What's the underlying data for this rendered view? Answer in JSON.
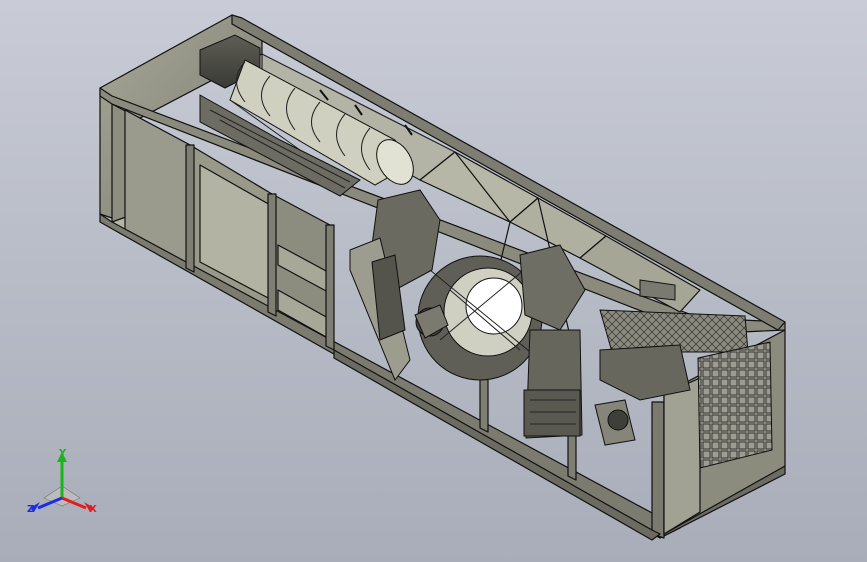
{
  "viewport": {
    "background_top": "#c9ccd6",
    "background_bottom": "#a9adb9"
  },
  "model": {
    "frame_color": "#8d8d80",
    "frame_edge_color": "#000000",
    "panel_color": "#9a9a8c",
    "equipment_color": "#6f6f66"
  },
  "triad": {
    "y_label": "Y",
    "x_label": "X",
    "z_label": "Z",
    "y_color": "#19b519",
    "x_color": "#e01e1e",
    "z_color": "#1c2ee0"
  }
}
